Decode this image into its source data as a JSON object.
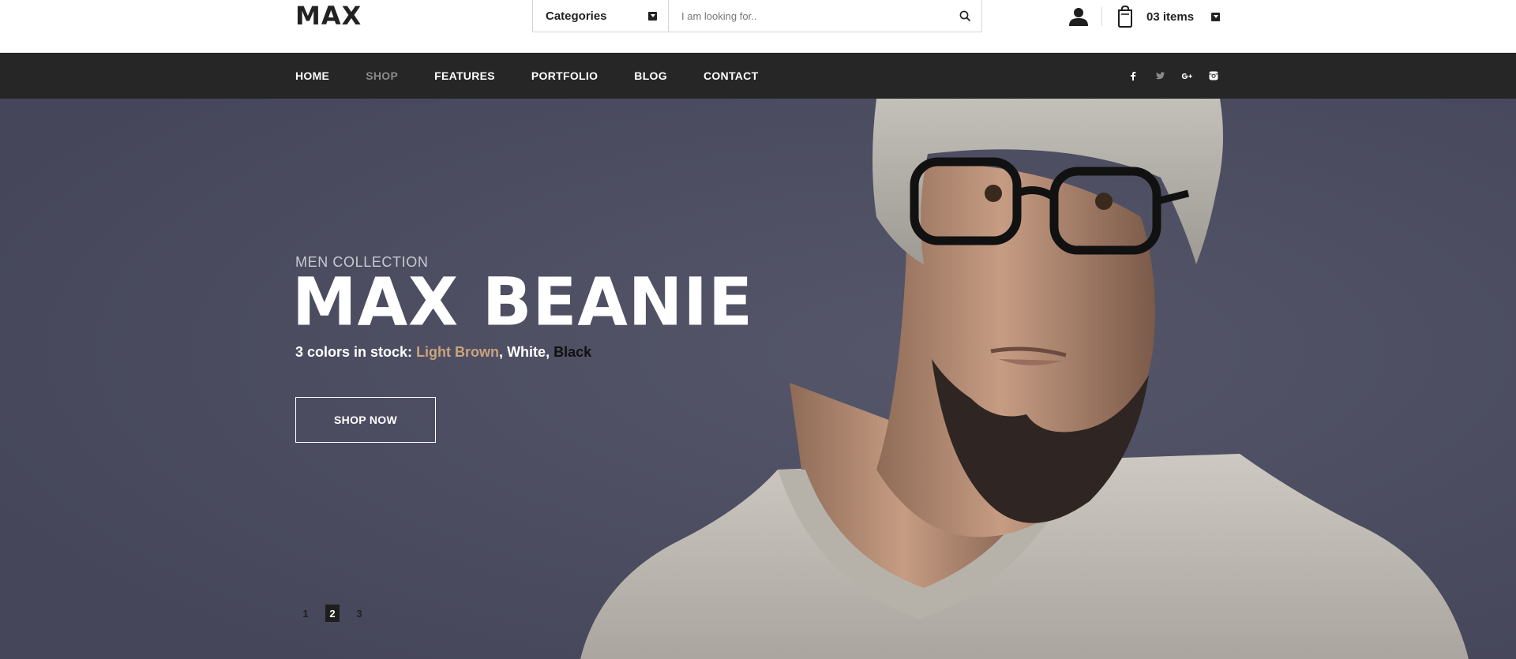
{
  "header": {
    "logo": "MAX",
    "categories_label": "Categories",
    "search_placeholder": "I am looking for..",
    "cart_count": "03 items"
  },
  "nav": {
    "items": [
      {
        "label": "HOME",
        "active": false
      },
      {
        "label": "SHOP",
        "active": true
      },
      {
        "label": "FEATURES",
        "active": false
      },
      {
        "label": "PORTFOLIO",
        "active": false
      },
      {
        "label": "BLOG",
        "active": false
      },
      {
        "label": "CONTACT",
        "active": false
      }
    ],
    "social": [
      "facebook-icon",
      "twitter-icon",
      "google-plus-icon",
      "instagram-icon"
    ]
  },
  "hero": {
    "subtitle": "MEN COLLECTION",
    "title": "MAX BEANIE",
    "stock_prefix": "3 colors in stock:",
    "color_1": "Light Brown",
    "color_2": "White",
    "color_3": "Black",
    "button": "SHOP NOW",
    "pages": [
      "1",
      "2",
      "3"
    ],
    "current_page": "2"
  },
  "colors": {
    "hero_bg": "#4a4b5a",
    "nav_bg": "#262626",
    "accent_brown": "#c9a37e"
  }
}
